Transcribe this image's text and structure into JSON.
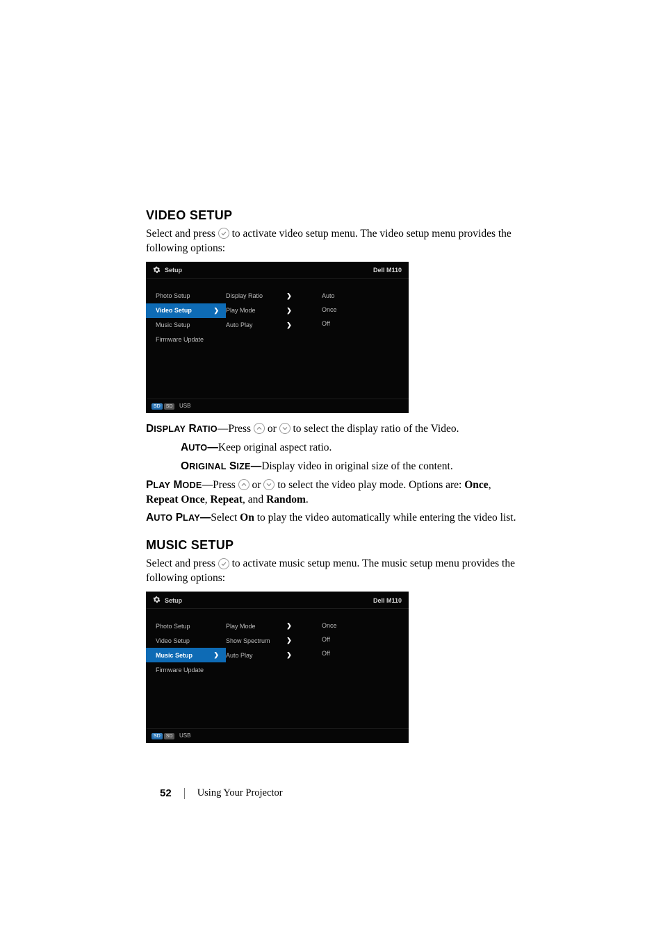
{
  "sections": {
    "video": {
      "heading": "VIDEO SETUP",
      "intro_a": "Select and press ",
      "intro_b": " to activate video setup menu. The video setup menu provides the following options:",
      "display_ratio": {
        "prefix": "D",
        "prefix2": "ISPLAY",
        "word2a": "R",
        "word2b": "ATIO",
        "dash_press": "—Press ",
        "or": " or ",
        "tail": " to select the display ratio of the Video."
      },
      "auto": {
        "a": "A",
        "b": "UTO",
        "dash": "—",
        "text": "Keep original aspect ratio."
      },
      "original": {
        "a": "O",
        "b": "RIGINAL",
        "c": "S",
        "d": "IZE",
        "dash": "—",
        "text": "Display video in original size of the content."
      },
      "play_mode": {
        "a": "P",
        "b": "LAY",
        "c": "M",
        "d": "ODE",
        "dash_press": "—Press ",
        "or": " or ",
        "tail_a": " to select the video play mode. Options are: ",
        "opt1": "Once",
        "sep1": ", ",
        "opt2": "Repeat Once",
        "sep2": ", ",
        "opt3": "Repeat",
        "sep3": ", and ",
        "opt4": "Random",
        "period": "."
      },
      "auto_play": {
        "a": "A",
        "b": "UTO",
        "c": "P",
        "d": "LAY",
        "dash": "—",
        "text_a": "Select ",
        "on": "On",
        "text_b": " to play the video automatically while entering the video list."
      }
    },
    "music": {
      "heading": "MUSIC SETUP",
      "intro_a": "Select and press ",
      "intro_b": " to activate music setup menu. The music setup menu provides the following options:"
    }
  },
  "osd": {
    "title": "Setup",
    "model": "Dell M110",
    "sd_left": "SD",
    "sd_right": "SD",
    "usb": "USB",
    "video": {
      "col1": [
        "Photo Setup",
        "Video Setup",
        "Music Setup",
        "Firmware Update"
      ],
      "selected_index": 1,
      "rows": [
        {
          "label": "Display Ratio",
          "value": "Auto"
        },
        {
          "label": "Play Mode",
          "value": "Once"
        },
        {
          "label": "Auto Play",
          "value": "Off"
        }
      ]
    },
    "music": {
      "col1": [
        "Photo Setup",
        "Video Setup",
        "Music Setup",
        "Firmware Update"
      ],
      "selected_index": 2,
      "rows": [
        {
          "label": "Play Mode",
          "value": "Once"
        },
        {
          "label": "Show Spectrum",
          "value": "Off"
        },
        {
          "label": "Auto Play",
          "value": "Off"
        }
      ]
    }
  },
  "footer": {
    "page_number": "52",
    "text": "Using Your Projector"
  }
}
